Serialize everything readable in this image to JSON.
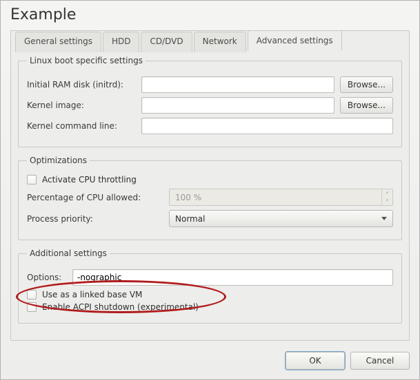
{
  "window": {
    "title": "Example"
  },
  "tabs": {
    "general": "General settings",
    "hdd": "HDD",
    "cddvd": "CD/DVD",
    "network": "Network",
    "advanced": "Advanced settings"
  },
  "linux": {
    "legend": "Linux boot specific settings",
    "initrd_label": "Initial RAM disk (initrd):",
    "initrd_value": "",
    "kernel_label": "Kernel image:",
    "kernel_value": "",
    "cmdline_label": "Kernel command line:",
    "cmdline_value": "",
    "browse": "Browse..."
  },
  "optim": {
    "legend": "Optimizations",
    "throttle_label": "Activate CPU throttling",
    "pct_label": "Percentage of CPU allowed:",
    "pct_value": "100 %",
    "prio_label": "Process priority:",
    "prio_value": "Normal"
  },
  "additional": {
    "legend": "Additional settings",
    "options_label": "Options:",
    "options_value": "-nographic",
    "linked_label": "Use as a linked base VM",
    "acpi_label": "Enable ACPI shutdown (experimental)"
  },
  "buttons": {
    "ok": "OK",
    "cancel": "Cancel"
  }
}
